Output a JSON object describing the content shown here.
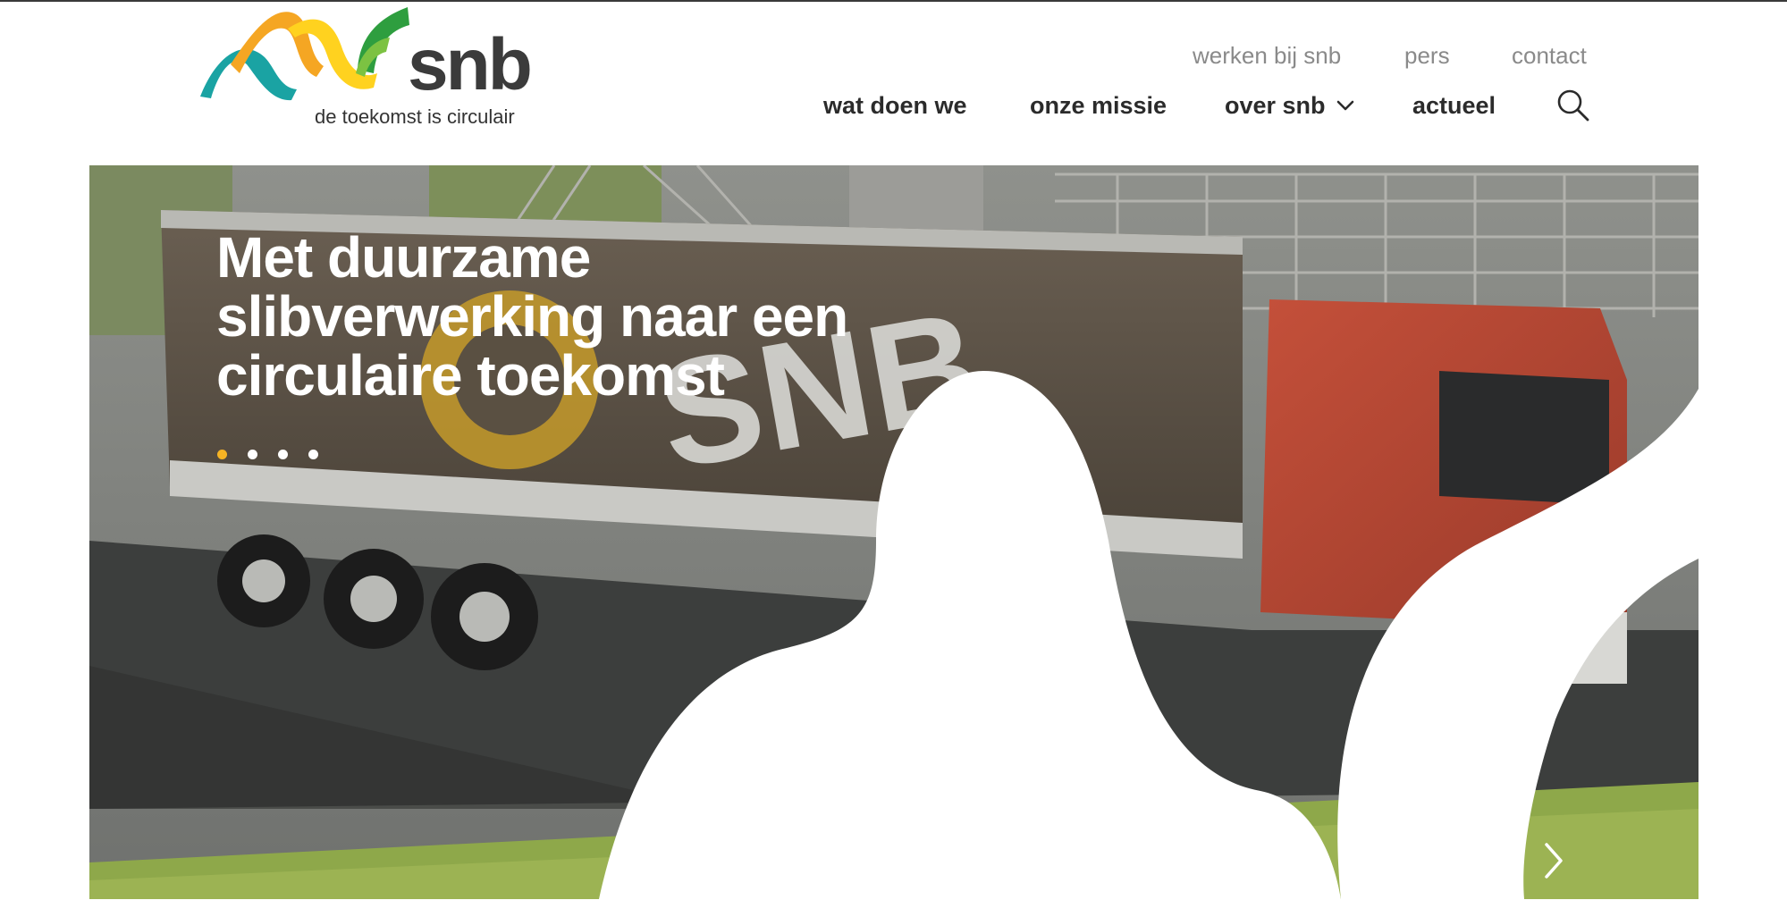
{
  "brand": {
    "name": "snb",
    "tagline": "de toekomst is circulair",
    "colors": {
      "teal": "#1aa3a3",
      "orange": "#f5a623",
      "yellow": "#ffd21f",
      "green": "#2e9e3f",
      "dark": "#3b3b3b"
    }
  },
  "utility_nav": [
    {
      "label": "werken bij snb"
    },
    {
      "label": "pers"
    },
    {
      "label": "contact"
    }
  ],
  "main_nav": [
    {
      "label": "wat doen we"
    },
    {
      "label": "onze missie"
    },
    {
      "label": "over snb",
      "icon": "chevron-down-icon"
    },
    {
      "label": "actueel"
    }
  ],
  "search": {
    "icon": "search-icon"
  },
  "hero": {
    "title": "Met duurzame slibverwerking naar een circulaire toekomst",
    "truck_lettering": "SNB",
    "slides": {
      "count": 4,
      "active": 1
    },
    "controls": {
      "prev_icon": "chevron-left-icon",
      "next_icon": "chevron-right-icon"
    }
  }
}
